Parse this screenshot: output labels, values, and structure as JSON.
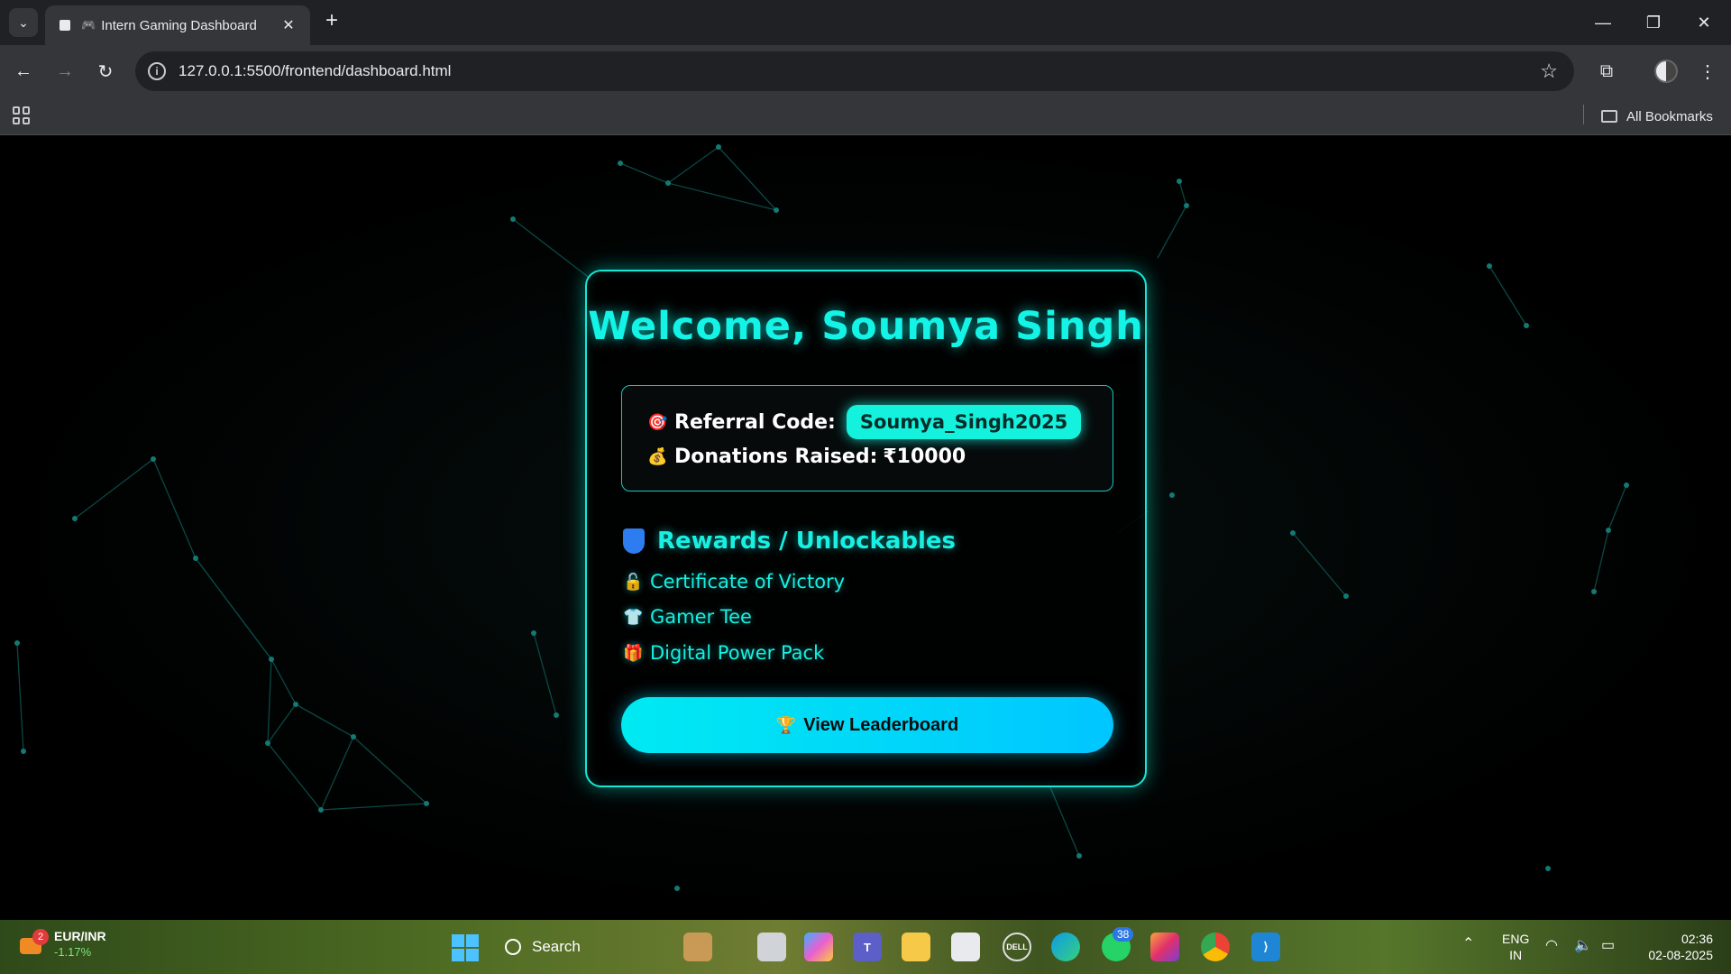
{
  "browser": {
    "tab_title": "Intern Gaming Dashboard",
    "url": "127.0.0.1:5500/frontend/dashboard.html",
    "all_bookmarks": "All Bookmarks"
  },
  "dashboard": {
    "welcome": "Welcome, Soumya Singh",
    "referral_label": "Referral Code:",
    "referral_code": "Soumya_Singh2025",
    "donations_label": "Donations Raised:",
    "donations_value": "₹10000",
    "rewards_title": "Rewards / Unlockables",
    "rewards": [
      {
        "emoji": "🔓",
        "label": "Certificate of Victory"
      },
      {
        "emoji": "👕",
        "label": "Gamer Tee"
      },
      {
        "emoji": "🎁",
        "label": "Digital Power Pack"
      }
    ],
    "leaderboard_button": "View Leaderboard",
    "emojis": {
      "referral": "🎯",
      "donations": "💰",
      "leaderboard": "🏆"
    }
  },
  "taskbar": {
    "fx_badge": "2",
    "fx_pair": "EUR/INR",
    "fx_change": "-1.17%",
    "search_label": "Search",
    "whatsapp_badge": "38",
    "language": "ENG",
    "region": "IN",
    "time": "02:36",
    "date": "02-08-2025"
  },
  "colors": {
    "accent": "#13f3e6",
    "button_start": "#00eaf2",
    "button_end": "#00c6ff"
  }
}
